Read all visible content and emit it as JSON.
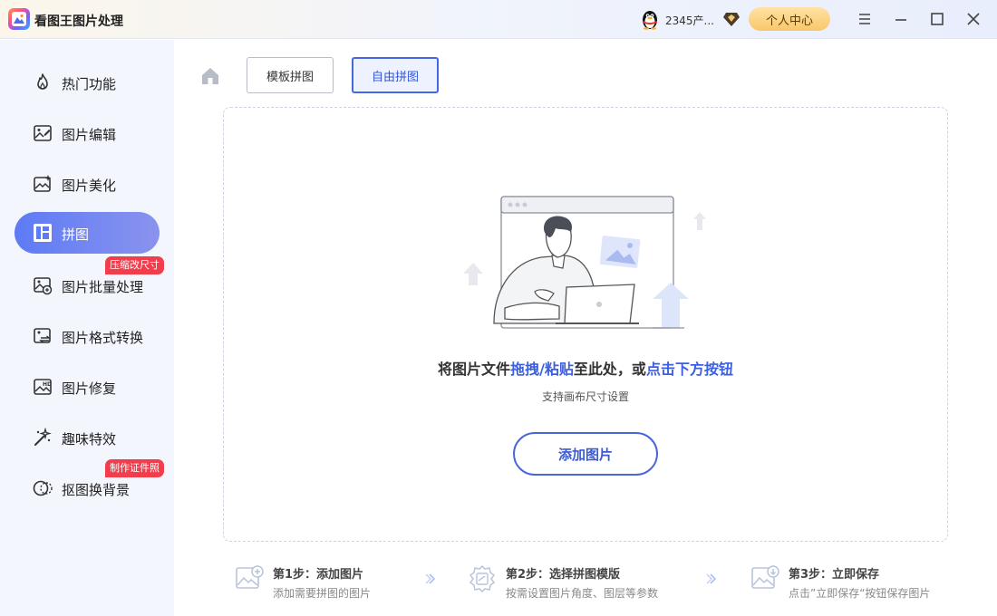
{
  "app": {
    "title": "看图王图片处理"
  },
  "account": {
    "username": "2345产...",
    "profile_label": "个人中心"
  },
  "window_controls": [
    "menu-icon",
    "minimize-icon",
    "maximize-icon",
    "close-icon"
  ],
  "sidebar": {
    "items": [
      {
        "label": "热门功能",
        "icon": "flame-icon"
      },
      {
        "label": "图片编辑",
        "icon": "image-edit-icon"
      },
      {
        "label": "图片美化",
        "icon": "image-beautify-icon"
      },
      {
        "label": "拼图",
        "icon": "collage-icon",
        "active": true
      },
      {
        "label": "图片批量处理",
        "icon": "batch-image-icon"
      },
      {
        "label": "图片格式转换",
        "icon": "format-convert-icon"
      },
      {
        "label": "图片修复",
        "icon": "hd-repair-icon"
      },
      {
        "label": "趣味特效",
        "icon": "magic-wand-icon"
      },
      {
        "label": "抠图换背景",
        "icon": "cutout-icon"
      }
    ],
    "badges": {
      "compress": "压缩改尺寸",
      "id_photo": "制作证件照"
    }
  },
  "tabs": {
    "template": "模板拼图",
    "free": "自由拼图",
    "active": "free"
  },
  "dropzone": {
    "text_before": "将图片文件",
    "text_highlight_1": "拖拽/粘贴",
    "text_middle": "至此处，或",
    "text_highlight_2": "点击下方按钮",
    "subtext": "支持画布尺寸设置",
    "button_label": "添加图片"
  },
  "steps": [
    {
      "title": "第1步：添加图片",
      "desc": "添加需要拼图的图片",
      "icon": "add-image-icon"
    },
    {
      "title": "第2步：选择拼图模版",
      "desc": "按需设置图片角度、图层等参数",
      "icon": "settings-image-icon"
    },
    {
      "title": "第3步：立即保存",
      "desc": "点击”立即保存“按钮保存图片",
      "icon": "save-image-icon"
    }
  ],
  "colors": {
    "accent": "#3b5fe0",
    "badge": "#f23d4c",
    "profile_btn": "#f8c76a",
    "sidebar_bg": "#f4f6fd"
  }
}
